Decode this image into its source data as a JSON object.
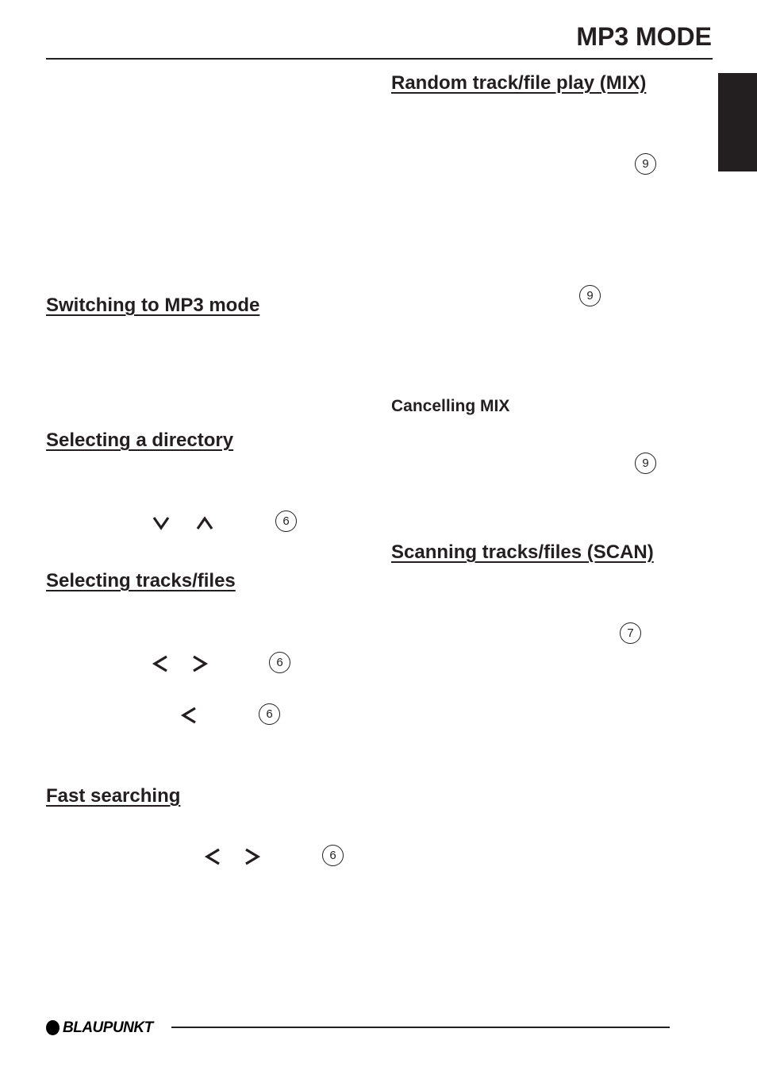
{
  "header": {
    "title": "MP3 MODE"
  },
  "left_column": {
    "sections": [
      {
        "heading": "Switching to MP3 mode"
      },
      {
        "heading": "Selecting a directory",
        "keys": [
          "down-arrow",
          "up-arrow"
        ],
        "ref": "6"
      },
      {
        "heading": "Selecting tracks/files",
        "keys": [
          "left-arrow",
          "right-arrow"
        ],
        "ref": "6",
        "second_key": "left-arrow",
        "second_ref": "6"
      },
      {
        "heading": "Fast searching",
        "keys": [
          "left-arrow",
          "right-arrow"
        ],
        "ref": "6"
      }
    ]
  },
  "right_column": {
    "sections": [
      {
        "heading": "Random track/file play (MIX)",
        "refs": [
          "9",
          "9"
        ]
      },
      {
        "subheading": "Cancelling MIX",
        "ref": "9"
      },
      {
        "heading": "Scanning tracks/files (SCAN)",
        "ref": "7"
      }
    ]
  },
  "footer": {
    "brand": "BLAUPUNKT"
  }
}
